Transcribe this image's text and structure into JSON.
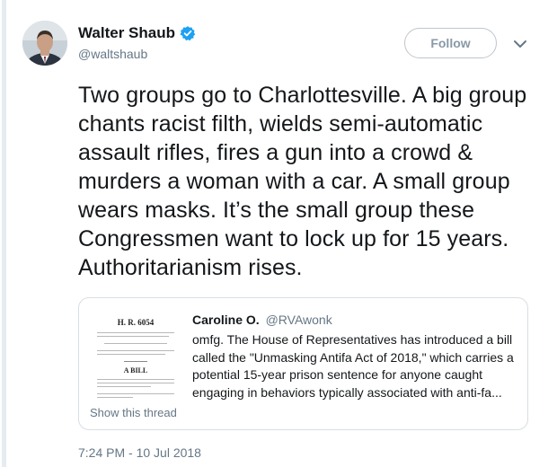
{
  "author": {
    "display_name": "Walter Shaub",
    "handle": "@waltshaub",
    "verified": true
  },
  "follow_button": {
    "label": "Follow"
  },
  "menu": {
    "icon": "chevron-down-icon"
  },
  "tweet": {
    "text": "Two groups go to Charlottesville. A big group chants racist filth, wields semi-automatic assault rifles, fires a gun into a crowd & murders a woman with a car. A small group wears masks. It’s the small group these Congressmen want to lock up for 15 years. Authoritarianism rises.",
    "timestamp": "7:24 PM - 10 Jul 2018"
  },
  "quoted_tweet": {
    "author_name": "Caroline O.",
    "author_handle": "@RVAwonk",
    "text": "omfg. The House of Representatives has introduced a bill called the \"Unmasking Antifa Act of 2018,\" which carries a potential 15-year prison sentence for anyone caught engaging in behaviors typically associated with anti-fa...",
    "show_thread_label": "Show this thread",
    "thumbnail": {
      "bill_number": "H. R. 6054",
      "heading": "A BILL"
    }
  },
  "colors": {
    "text_primary": "#14171a",
    "text_secondary": "#657786",
    "verified_blue": "#1da1f2",
    "border": "#d8dee2"
  }
}
